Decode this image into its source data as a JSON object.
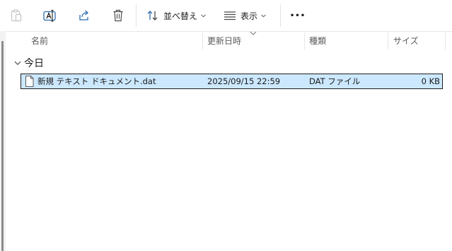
{
  "toolbar": {
    "sort_label": "並べ替え",
    "view_label": "表示",
    "more_label": "•••"
  },
  "columns": {
    "name": "名前",
    "date_modified": "更新日時",
    "type": "種類",
    "size": "サイズ"
  },
  "group": {
    "label": "今日"
  },
  "files": [
    {
      "name": "新規 テキスト ドキュメント.dat",
      "date_modified": "2025/09/15 22:59",
      "type": "DAT ファイル",
      "size": "0 KB"
    }
  ],
  "colors": {
    "selection_bg": "#cce8ff",
    "selection_border": "#1f1f1f",
    "icon": "#4a4a4a",
    "icon_disabled": "#c4c4c4"
  }
}
